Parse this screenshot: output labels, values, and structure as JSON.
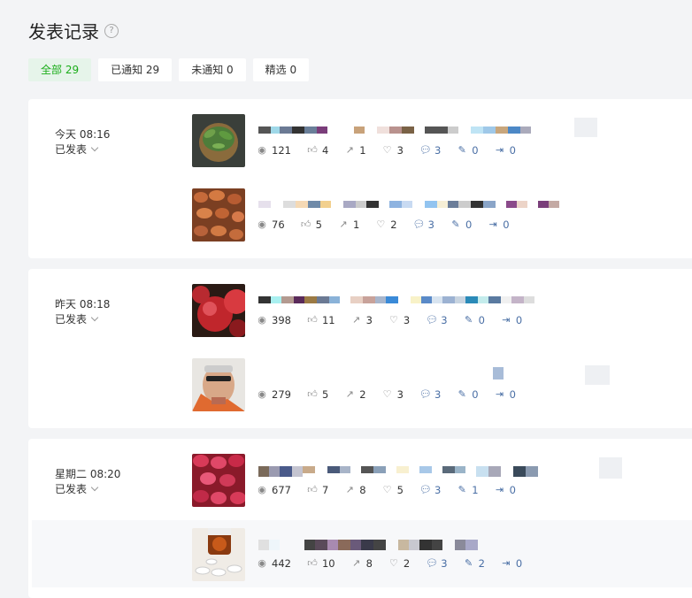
{
  "page": {
    "title": "发表记录",
    "help_icon": "question-circle-icon"
  },
  "filters": [
    {
      "label": "全部 29",
      "active": true
    },
    {
      "label": "已通知 29",
      "active": false
    },
    {
      "label": "未通知 0",
      "active": false
    },
    {
      "label": "精选 0",
      "active": false
    }
  ],
  "groups": [
    {
      "time": "今天 08:16",
      "status": "已发表",
      "articles": [
        {
          "image": "green leaves in a bowl",
          "stats": {
            "read": "121",
            "like": "4",
            "share": "1",
            "wow": "3",
            "comment": "3",
            "edit": "0",
            "export": "0"
          }
        },
        {
          "image": "red beans",
          "stats": {
            "read": "76",
            "like": "5",
            "share": "1",
            "wow": "2",
            "comment": "3",
            "edit": "0",
            "export": "0"
          }
        }
      ]
    },
    {
      "time": "昨天 08:18",
      "status": "已发表",
      "articles": [
        {
          "image": "red apples",
          "stats": {
            "read": "398",
            "like": "11",
            "share": "3",
            "wow": "3",
            "comment": "3",
            "edit": "0",
            "export": "0"
          }
        },
        {
          "image": "portrait of a man",
          "stats": {
            "read": "279",
            "like": "5",
            "share": "2",
            "wow": "3",
            "comment": "3",
            "edit": "0",
            "export": "0"
          }
        }
      ]
    },
    {
      "time": "星期二 08:20",
      "status": "已发表",
      "articles": [
        {
          "image": "red jelly candies",
          "stats": {
            "read": "677",
            "like": "7",
            "share": "8",
            "wow": "5",
            "comment": "3",
            "edit": "1",
            "export": "0"
          }
        },
        {
          "image": "pill bottle and tablets",
          "stats": {
            "read": "442",
            "like": "10",
            "share": "8",
            "wow": "2",
            "comment": "3",
            "edit": "2",
            "export": "0"
          }
        }
      ]
    }
  ]
}
